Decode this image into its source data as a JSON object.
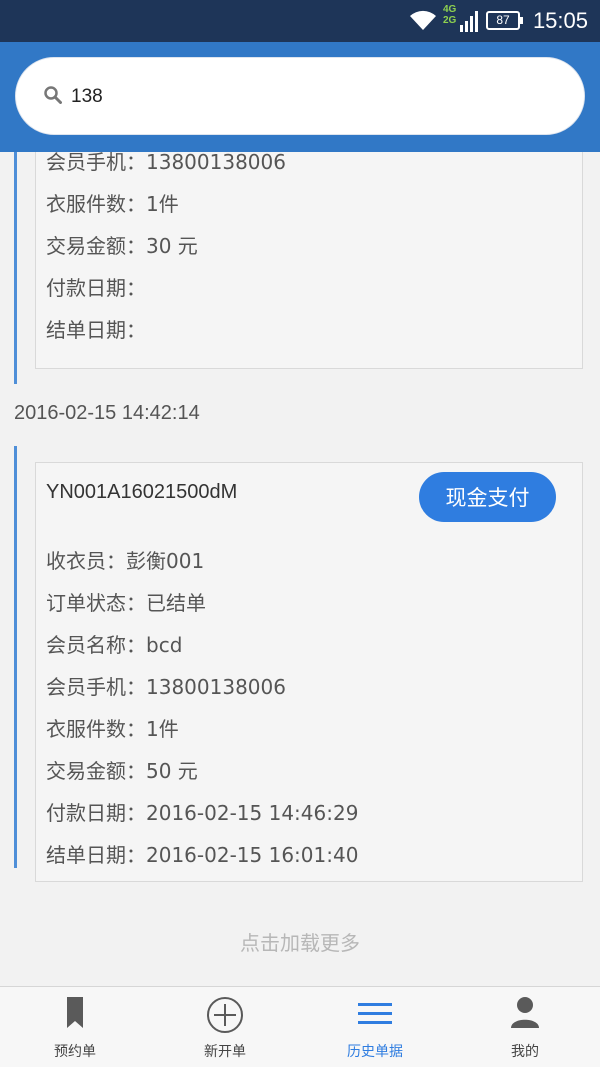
{
  "status_bar": {
    "time": "15:05",
    "battery": "87",
    "network_top": "4G",
    "network_bottom": "2G"
  },
  "search": {
    "value": "138",
    "placeholder": ""
  },
  "orders": [
    {
      "partial": true,
      "fields": [
        {
          "label": "会员手机：",
          "value": "13800138006"
        },
        {
          "label": "衣服件数：",
          "value": "1件"
        },
        {
          "label": "交易金额：",
          "value": "30 元"
        },
        {
          "label": "付款日期：",
          "value": ""
        },
        {
          "label": "结单日期：",
          "value": ""
        }
      ]
    },
    {
      "timestamp": "2016-02-15 14:42:14",
      "order_no": "YN001A16021500dM",
      "pay_button": "现金支付",
      "fields": [
        {
          "label": "收衣员：",
          "value": "彭衡001"
        },
        {
          "label": "订单状态：",
          "value": "已结单"
        },
        {
          "label": "会员名称：",
          "value": "bcd"
        },
        {
          "label": "会员手机：",
          "value": "13800138006"
        },
        {
          "label": "衣服件数：",
          "value": "1件"
        },
        {
          "label": "交易金额：",
          "value": "50 元"
        },
        {
          "label": "付款日期：",
          "value": "2016-02-15 14:46:29"
        },
        {
          "label": "结单日期：",
          "value": "2016-02-15 16:01:40"
        }
      ]
    }
  ],
  "load_more": "点击加载更多",
  "tabs": [
    {
      "label": "预约单",
      "icon": "bookmark-icon",
      "active": false
    },
    {
      "label": "新开单",
      "icon": "add-circle-icon",
      "active": false
    },
    {
      "label": "历史单据",
      "icon": "list-icon",
      "active": true
    },
    {
      "label": "我的",
      "icon": "person-icon",
      "active": false
    }
  ],
  "colors": {
    "status_bar": "#1e3558",
    "header": "#3178c6",
    "accent": "#2f7de0",
    "rail": "#4f8fd8"
  }
}
